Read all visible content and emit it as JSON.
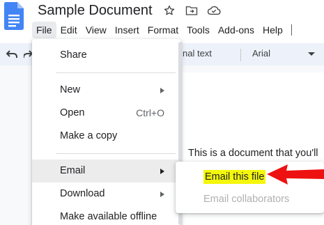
{
  "app": {
    "title": "Sample Document",
    "icons": [
      "docs-logo-icon",
      "star-icon",
      "move-to-folder-icon",
      "cloud-status-icon"
    ]
  },
  "menubar": {
    "items": [
      "File",
      "Edit",
      "View",
      "Insert",
      "Format",
      "Tools",
      "Add-ons",
      "Help"
    ],
    "active": "File"
  },
  "toolbar": {
    "style_value": "nal text",
    "font_value": "Arial",
    "icons": [
      "undo-icon",
      "redo-icon",
      "dropdown-arrow-icon"
    ]
  },
  "file_menu": {
    "items": [
      {
        "label": "Share"
      },
      {
        "label": "New",
        "submenu": true
      },
      {
        "label": "Open",
        "shortcut": "Ctrl+O"
      },
      {
        "label": "Make a copy"
      },
      {
        "label": "Email",
        "submenu": true,
        "highlighted": true
      },
      {
        "label": "Download",
        "submenu": true
      },
      {
        "label": "Make available offline"
      }
    ]
  },
  "email_submenu": {
    "items": [
      {
        "label": "Email this file",
        "highlighted": true,
        "highlight_color": "#f4f70b"
      },
      {
        "label": "Email collaborators",
        "disabled": true
      }
    ]
  },
  "document": {
    "text": "This is a document that you'll"
  },
  "annotation": {
    "arrow_color": "#ee1111"
  }
}
